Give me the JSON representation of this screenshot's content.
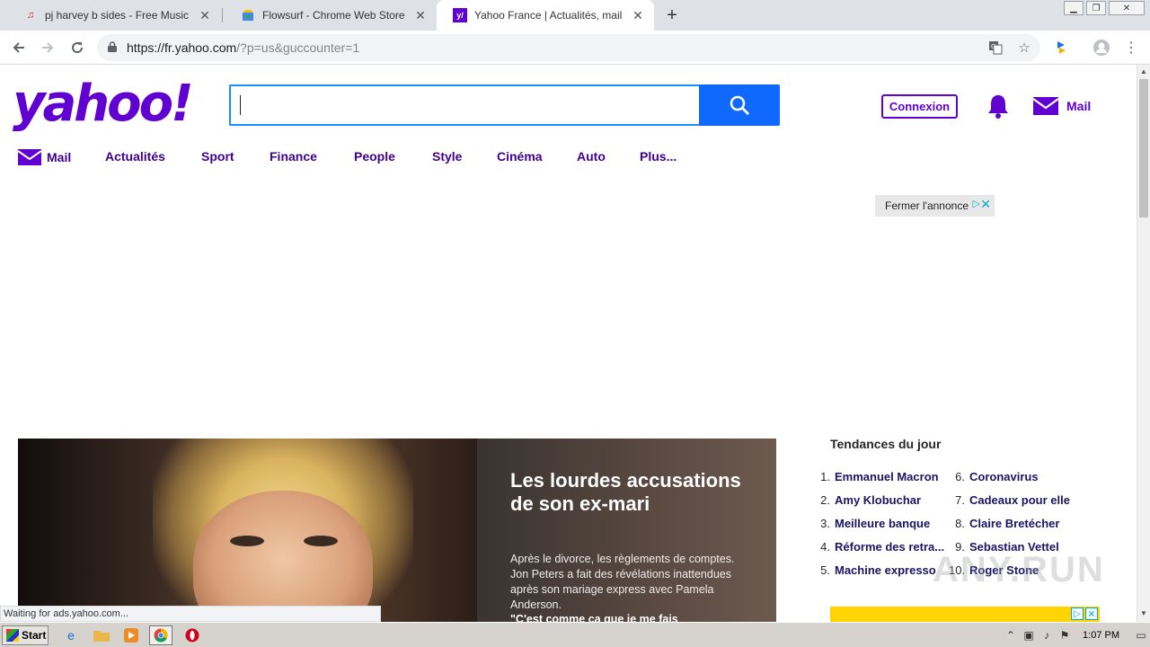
{
  "browser": {
    "tabs": [
      {
        "title": "pj harvey b sides - Free Music Downl",
        "favicon": "music-note-icon"
      },
      {
        "title": "Flowsurf - Chrome Web Store",
        "favicon": "chrome-webstore-icon"
      },
      {
        "title": "Yahoo France | Actualités, mail et re",
        "favicon": "yahoo-favicon",
        "active": true
      }
    ],
    "new_tab_label": "+",
    "url_host": "https://fr.yahoo.com",
    "url_path": "/?p=us&guccounter=1"
  },
  "yahoo": {
    "logo_text": "yahoo!",
    "search_value": "",
    "sign_in_label": "Connexion",
    "mail_label": "Mail",
    "nav": [
      "Mail",
      "Actualités",
      "Sport",
      "Finance",
      "People",
      "Style",
      "Cinéma",
      "Auto",
      "Plus..."
    ],
    "ad_close_label": "Fermer l'annonce",
    "hero": {
      "title": "Les lourdes accusations de son ex-mari",
      "text": "Après le divorce, les règlements de comptes. Jon Peters a fait des révélations inattendues après son mariage express avec Pamela Anderson.",
      "quote": "\"C'est comme ça que je me fais"
    },
    "trends_title": "Tendances du jour",
    "trends": [
      {
        "num": "1.",
        "term": "Emmanuel Macron"
      },
      {
        "num": "2.",
        "term": "Amy Klobuchar"
      },
      {
        "num": "3.",
        "term": "Meilleure banque"
      },
      {
        "num": "4.",
        "term": "Réforme des retra..."
      },
      {
        "num": "5.",
        "term": "Machine expresso"
      },
      {
        "num": "6.",
        "term": "Coronavirus"
      },
      {
        "num": "7.",
        "term": "Cadeaux pour elle"
      },
      {
        "num": "8.",
        "term": "Claire Bretécher"
      },
      {
        "num": "9.",
        "term": "Sebastian Vettel"
      },
      {
        "num": "10.",
        "term": "Roger Stone"
      }
    ],
    "watermark": "ANY.RUN"
  },
  "status_bubble": "Waiting for ads.yahoo.com...",
  "taskbar": {
    "start_label": "Start",
    "clock": "1:07 PM"
  },
  "colors": {
    "yahoo_purple": "#6001d2",
    "nav_purple": "#400090",
    "search_blue": "#0f69ff"
  }
}
